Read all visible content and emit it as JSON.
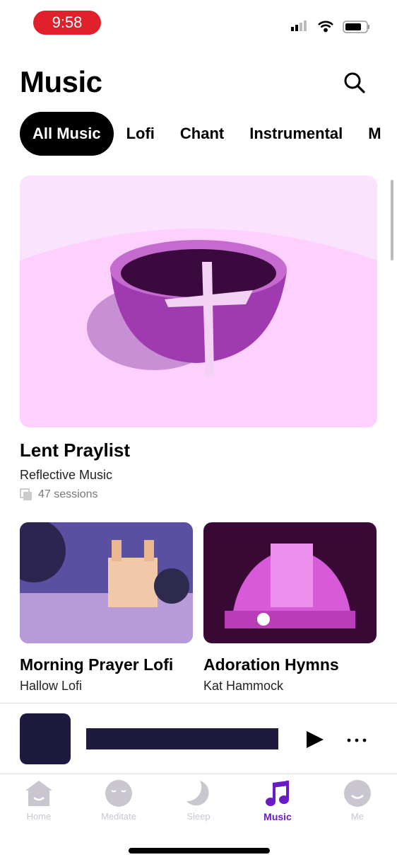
{
  "status": {
    "time": "9:58"
  },
  "header": {
    "title": "Music"
  },
  "filters": [
    {
      "label": "All Music",
      "active": true
    },
    {
      "label": "Lofi"
    },
    {
      "label": "Chant"
    },
    {
      "label": "Instrumental"
    },
    {
      "label": "M"
    }
  ],
  "featured": {
    "title": "Lent Praylist",
    "subtitle": "Reflective Music",
    "sessions": "47 sessions"
  },
  "cards": [
    {
      "title": "Morning Prayer Lofi",
      "subtitle": "Hallow Lofi"
    },
    {
      "title": "Adoration Hymns",
      "subtitle": "Kat Hammock"
    }
  ],
  "tabs": [
    {
      "label": "Home"
    },
    {
      "label": "Meditate"
    },
    {
      "label": "Sleep"
    },
    {
      "label": "Music",
      "active": true
    },
    {
      "label": "Me"
    }
  ],
  "colors": {
    "accent": "#6a1cc4",
    "player_dark": "#1e1a3d",
    "tab_inactive": "#c9c6d0"
  }
}
